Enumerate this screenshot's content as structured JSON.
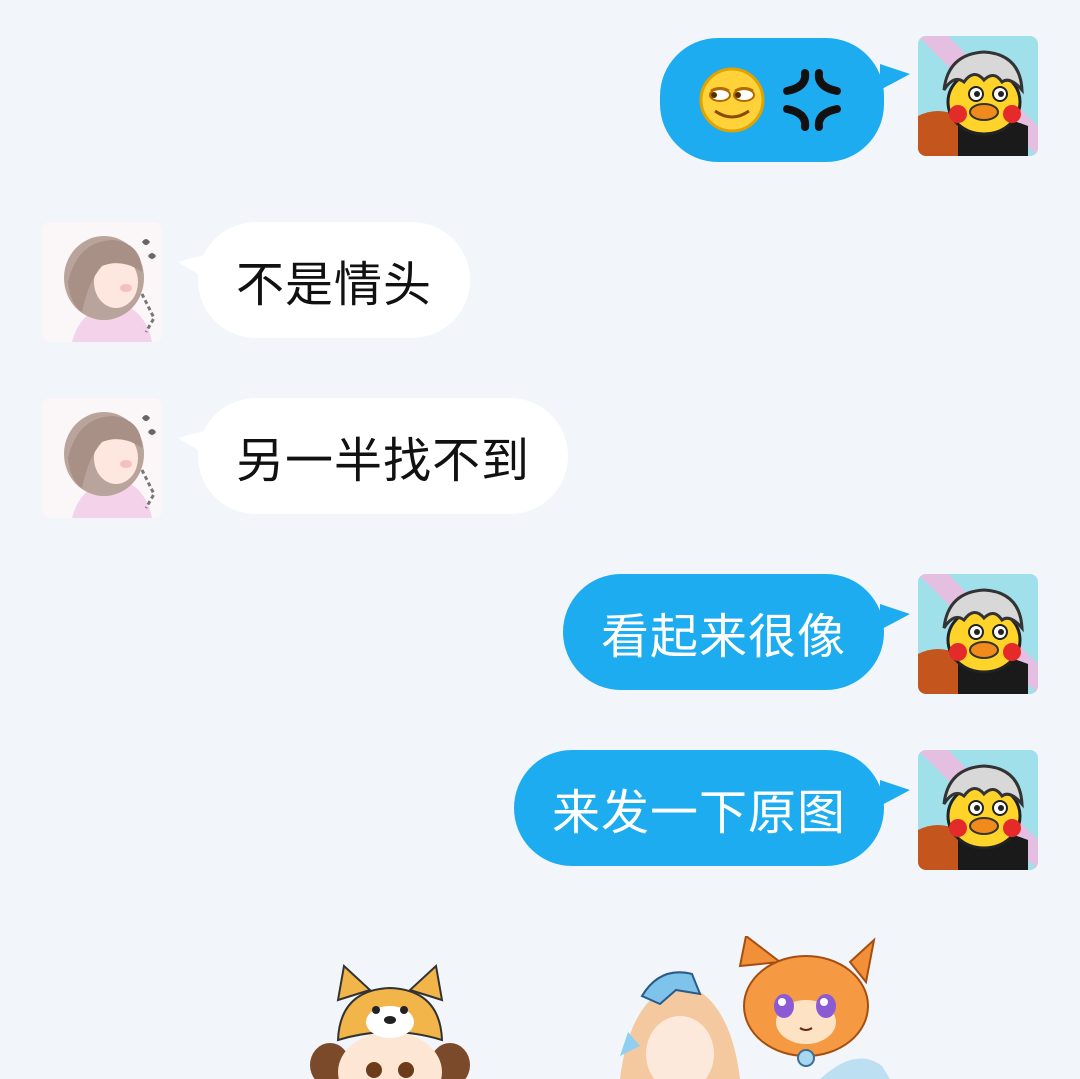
{
  "messages": [
    {
      "side": "out",
      "type": "emoji",
      "icons": [
        "smirk-emoji-icon",
        "anger-symbol-icon"
      ]
    },
    {
      "side": "in",
      "text": "不是情头"
    },
    {
      "side": "in",
      "text": "另一半找不到"
    },
    {
      "side": "out",
      "text": "看起来很像"
    },
    {
      "side": "out",
      "text": "来发一下原图"
    }
  ],
  "colors": {
    "background": "#f2f5f9",
    "outgoing_bubble": "#1eacf0",
    "incoming_bubble": "#ffffff"
  },
  "avatars": {
    "me": "grey-haired-duck-avatar",
    "other": "pink-anime-girl-avatar"
  },
  "stickers": [
    "shiba-hat-girl-sticker",
    "anime-girl-with-orange-fox-sticker"
  ]
}
